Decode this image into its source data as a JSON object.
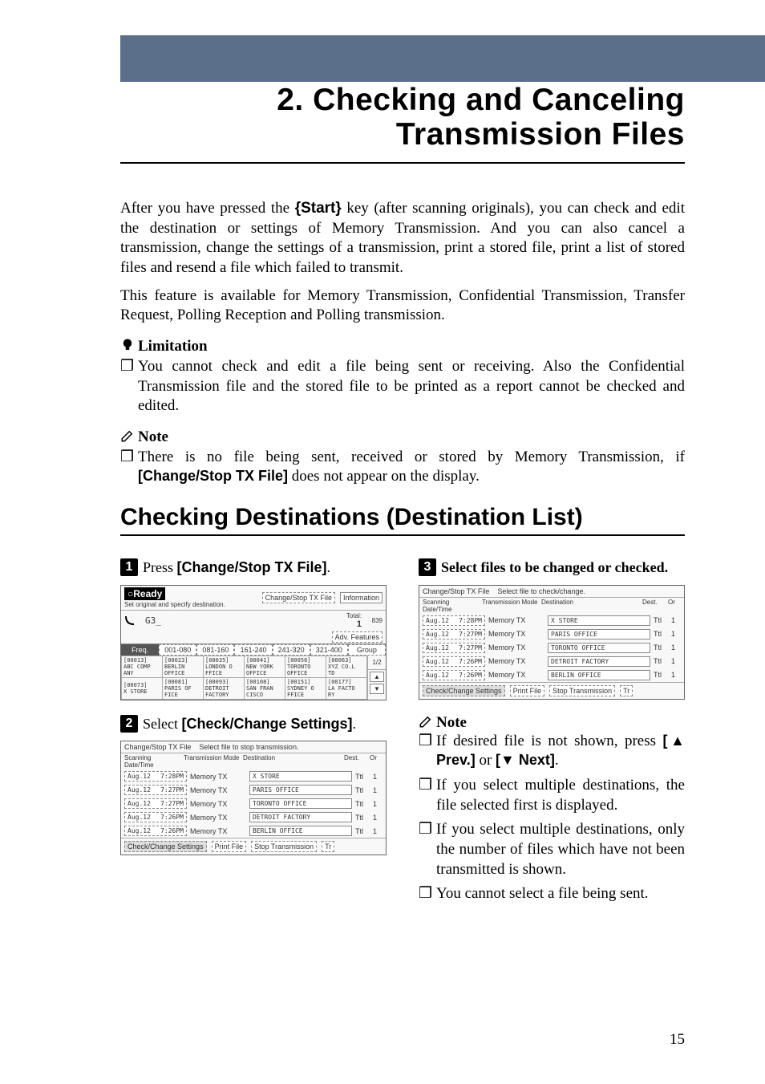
{
  "chapter": {
    "line1": "2. Checking and Canceling",
    "line2": "Transmission Files"
  },
  "intro": {
    "p1": "After you have pressed the {Start} key (after scanning originals), you can check and edit the destination or settings of Memory Transmission. And you can also cancel a transmission, change the settings of a transmission, print a stored file, print a list of stored files and resend a file which failed to transmit.",
    "p2": "This feature is available for Memory Transmission, Confidential Transmission, Transfer Request, Polling Reception and Polling transmission."
  },
  "limitation": {
    "heading": "Limitation",
    "item": "You cannot check and edit a file being sent or receiving. Also the Confidential Transmission file and the stored file to be printed as a report cannot be checked and edited."
  },
  "note1": {
    "heading": "Note",
    "item_pre": "There is no file being sent, received or stored by Memory Transmission, if ",
    "item_bold": "[Change/Stop TX File]",
    "item_post": " does not appear on the display."
  },
  "section_title": "Checking Destinations (Destination List)",
  "steps": {
    "s1": {
      "pre": "Press ",
      "bold": "[Change/Stop TX File]",
      "post": "."
    },
    "s2": {
      "pre": "Select ",
      "bold": "[Check/Change Settings]",
      "post": "."
    },
    "s3": {
      "pre": "Select files to be changed or checked.",
      "bold": "",
      "post": ""
    }
  },
  "ss1": {
    "ready": "Ready",
    "sub": "Set original and specify destination.",
    "btn_txfile": "Change/Stop TX File",
    "btn_info": "Information",
    "mem_pct": "839",
    "total_label": "Total:",
    "total_val": "1",
    "adv_btn": "Adv. Features",
    "tabs": [
      "Freq.",
      "001-080",
      "081-160",
      "161-240",
      "241-320",
      "321-400",
      "Group"
    ],
    "cells": [
      [
        "[00013]\nABC COMP\nANY",
        "[00023]\nBERLIN\nOFFICE",
        "[00035]\nLONDON O\nFFICE",
        "[00041]\nNEW YORK\nOFFICE",
        "[00056]\nTORONTO\nOFFICE",
        "[00063]\nXYZ CO.L\nTD"
      ],
      [
        "[00073]\nX STORE",
        "[00081]\nPARIS OF\nFICE",
        "[00093]\nDETROIT\nFACTORY",
        "[00108]\nSAN FRAN\nCISCO",
        "[00151]\nSYDNEY O\nFFICE",
        "[00177]\nLA FACTO\nRY"
      ]
    ],
    "page": "1/2",
    "up": "▲",
    "down": "▼"
  },
  "ss2": {
    "title": "Change/Stop TX File",
    "sub": "Select file to stop transmission.",
    "cols": [
      "Scanning Date/Time",
      "Transmission Mode",
      "Destination",
      "Dest.",
      "Or"
    ],
    "rows": [
      [
        "Aug.12",
        "7:28PM",
        "Memory TX",
        "X STORE",
        "Ttl",
        "1"
      ],
      [
        "Aug.12",
        "7:27PM",
        "Memory TX",
        "PARIS OFFICE",
        "Ttl",
        "1"
      ],
      [
        "Aug.12",
        "7:27PM",
        "Memory TX",
        "TORONTO OFFICE",
        "Ttl",
        "1"
      ],
      [
        "Aug.12",
        "7:26PM",
        "Memory TX",
        "DETROIT FACTORY",
        "Ttl",
        "1"
      ],
      [
        "Aug.12",
        "7:26PM",
        "Memory TX",
        "BERLIN OFFICE",
        "Ttl",
        "1"
      ]
    ],
    "foot_check": "Check/Change Settings",
    "foot_print": "Print File",
    "foot_stop": "Stop Transmission",
    "foot_tr": "Tr"
  },
  "ss3": {
    "title": "Change/Stop TX File",
    "sub": "Select file to check/change.",
    "cols": [
      "Scanning Date/Time",
      "Transmission Mode",
      "Destination",
      "Dest.",
      "Or"
    ],
    "rows": [
      [
        "Aug.12",
        "7:28PM",
        "Memory TX",
        "X STORE",
        "Ttl",
        "1"
      ],
      [
        "Aug.12",
        "7:27PM",
        "Memory TX",
        "PARIS OFFICE",
        "Ttl",
        "1"
      ],
      [
        "Aug.12",
        "7:27PM",
        "Memory TX",
        "TORONTO OFFICE",
        "Ttl",
        "1"
      ],
      [
        "Aug.12",
        "7:26PM",
        "Memory TX",
        "DETROIT FACTORY",
        "Ttl",
        "1"
      ],
      [
        "Aug.12",
        "7:26PM",
        "Memory TX",
        "BERLIN OFFICE",
        "Ttl",
        "1"
      ]
    ],
    "foot_check": "Check/Change Settings",
    "foot_print": "Print File",
    "foot_stop": "Stop Transmission",
    "foot_tr": "Tr"
  },
  "note2": {
    "heading": "Note",
    "items": [
      {
        "pre": "If desired file is not shown, press ",
        "bold1": "[▲ Prev.]",
        "mid": " or ",
        "bold2": "[▼ Next]",
        "post": "."
      },
      {
        "pre": "If you select multiple destinations, the file selected first is displayed.",
        "bold1": "",
        "mid": "",
        "bold2": "",
        "post": ""
      },
      {
        "pre": "If you select multiple destinations, only the number of files which have not been transmitted is shown.",
        "bold1": "",
        "mid": "",
        "bold2": "",
        "post": ""
      },
      {
        "pre": "You cannot select a file being sent.",
        "bold1": "",
        "mid": "",
        "bold2": "",
        "post": ""
      }
    ]
  },
  "page_number": "15"
}
